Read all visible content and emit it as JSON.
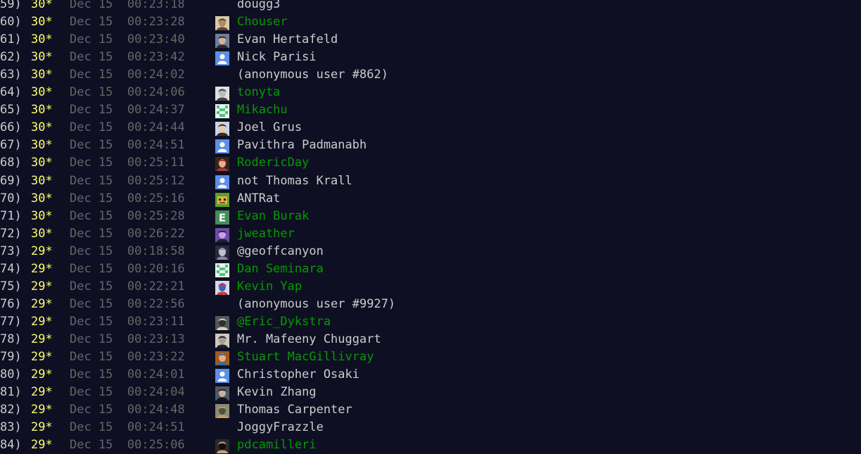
{
  "leaderboard": {
    "rows": [
      {
        "rank": "59)",
        "score": "30*",
        "timestamp": "Dec 15  00:23:18",
        "name": "dougg3",
        "linked": false,
        "avatar": "none"
      },
      {
        "rank": "60)",
        "score": "30*",
        "timestamp": "Dec 15  00:23:28",
        "name": "Chouser",
        "linked": true,
        "avatar": "photo"
      },
      {
        "rank": "61)",
        "score": "30*",
        "timestamp": "Dec 15  00:23:40",
        "name": "Evan Hertafeld",
        "linked": false,
        "avatar": "photo"
      },
      {
        "rank": "62)",
        "score": "30*",
        "timestamp": "Dec 15  00:23:42",
        "name": "Nick Parisi",
        "linked": false,
        "avatar": "default-user"
      },
      {
        "rank": "63)",
        "score": "30*",
        "timestamp": "Dec 15  00:24:02",
        "name": "(anonymous user #862)",
        "linked": false,
        "avatar": "none"
      },
      {
        "rank": "64)",
        "score": "30*",
        "timestamp": "Dec 15  00:24:06",
        "name": "tonyta",
        "linked": true,
        "avatar": "photo"
      },
      {
        "rank": "65)",
        "score": "30*",
        "timestamp": "Dec 15  00:24:37",
        "name": "Mikachu",
        "linked": true,
        "avatar": "identicon"
      },
      {
        "rank": "66)",
        "score": "30*",
        "timestamp": "Dec 15  00:24:44",
        "name": "Joel Grus",
        "linked": false,
        "avatar": "photo"
      },
      {
        "rank": "67)",
        "score": "30*",
        "timestamp": "Dec 15  00:24:51",
        "name": "Pavithra Padmanabh",
        "linked": false,
        "avatar": "default-user"
      },
      {
        "rank": "68)",
        "score": "30*",
        "timestamp": "Dec 15  00:25:11",
        "name": "RodericDay",
        "linked": true,
        "avatar": "photo"
      },
      {
        "rank": "69)",
        "score": "30*",
        "timestamp": "Dec 15  00:25:12",
        "name": "not Thomas Krall",
        "linked": false,
        "avatar": "default-user"
      },
      {
        "rank": "70)",
        "score": "30*",
        "timestamp": "Dec 15  00:25:16",
        "name": "ANTRat",
        "linked": false,
        "avatar": "pixel-art"
      },
      {
        "rank": "71)",
        "score": "30*",
        "timestamp": "Dec 15  00:25:28",
        "name": "Evan Burak",
        "linked": true,
        "avatar": "letter-e"
      },
      {
        "rank": "72)",
        "score": "30*",
        "timestamp": "Dec 15  00:26:22",
        "name": "jweather",
        "linked": true,
        "avatar": "photo"
      },
      {
        "rank": "73)",
        "score": "29*",
        "timestamp": "Dec 15  00:18:58",
        "name": "@geoffcanyon",
        "linked": false,
        "avatar": "photo"
      },
      {
        "rank": "74)",
        "score": "29*",
        "timestamp": "Dec 15  00:20:16",
        "name": "Dan Seminara",
        "linked": true,
        "avatar": "identicon"
      },
      {
        "rank": "75)",
        "score": "29*",
        "timestamp": "Dec 15  00:22:21",
        "name": "Kevin Yap",
        "linked": true,
        "avatar": "photo"
      },
      {
        "rank": "76)",
        "score": "29*",
        "timestamp": "Dec 15  00:22:56",
        "name": "(anonymous user #9927)",
        "linked": false,
        "avatar": "none"
      },
      {
        "rank": "77)",
        "score": "29*",
        "timestamp": "Dec 15  00:23:11",
        "name": "@Eric_Dykstra",
        "linked": true,
        "avatar": "photo"
      },
      {
        "rank": "78)",
        "score": "29*",
        "timestamp": "Dec 15  00:23:13",
        "name": "Mr. Mafeeny Chuggart",
        "linked": false,
        "avatar": "photo"
      },
      {
        "rank": "79)",
        "score": "29*",
        "timestamp": "Dec 15  00:23:22",
        "name": "Stuart MacGillivray",
        "linked": true,
        "avatar": "photo"
      },
      {
        "rank": "80)",
        "score": "29*",
        "timestamp": "Dec 15  00:24:01",
        "name": "Christopher Osaki",
        "linked": false,
        "avatar": "default-user"
      },
      {
        "rank": "81)",
        "score": "29*",
        "timestamp": "Dec 15  00:24:04",
        "name": "Kevin Zhang",
        "linked": false,
        "avatar": "photo"
      },
      {
        "rank": "82)",
        "score": "29*",
        "timestamp": "Dec 15  00:24:48",
        "name": "Thomas Carpenter",
        "linked": false,
        "avatar": "photo"
      },
      {
        "rank": "83)",
        "score": "29*",
        "timestamp": "Dec 15  00:24:51",
        "name": "JoggyFrazzle",
        "linked": false,
        "avatar": "none"
      },
      {
        "rank": "84)",
        "score": "29*",
        "timestamp": "Dec 15  00:25:06",
        "name": "pdcamilleri",
        "linked": true,
        "avatar": "photo"
      }
    ]
  },
  "colors": {
    "background": "#0f0f23",
    "text": "#cccccc",
    "star_score": "#ffff66",
    "timestamp": "#666666",
    "link": "#009900"
  }
}
